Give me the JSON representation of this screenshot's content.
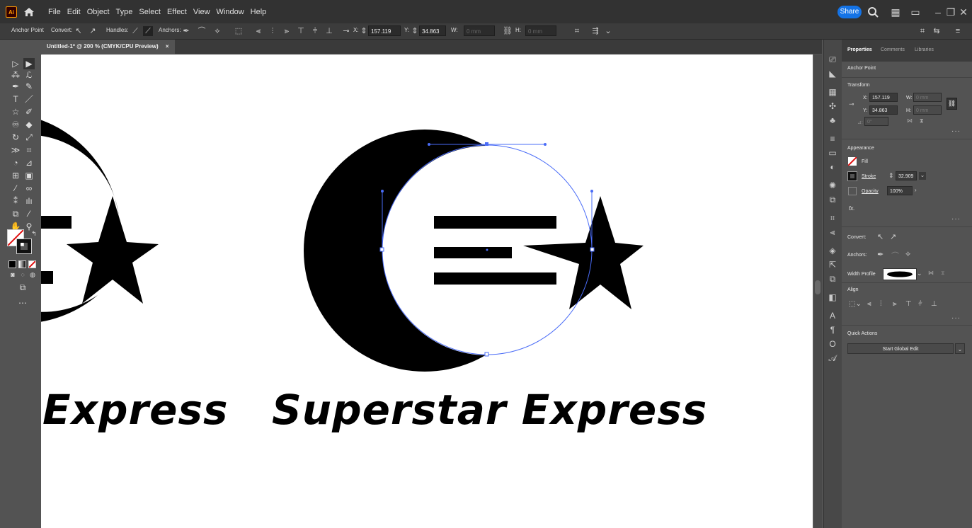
{
  "app": {
    "logo": "Ai"
  },
  "menu": [
    "File",
    "Edit",
    "Object",
    "Type",
    "Select",
    "Effect",
    "View",
    "Window",
    "Help"
  ],
  "topbar": {
    "share_label": "Share"
  },
  "control_bar": {
    "mode_label": "Anchor Point",
    "convert_label": "Convert:",
    "handles_label": "Handles:",
    "anchors_label": "Anchors:",
    "x_label": "X:",
    "x_value": "157.119 mm",
    "y_label": "Y:",
    "y_value": "34.863 mm",
    "w_label": "W:",
    "w_value": "0 mm",
    "h_label": "H:",
    "h_value": "0 mm"
  },
  "document_tab": {
    "title": "Untitled-1* @ 200 % (CMYK/CPU Preview)",
    "close": "×"
  },
  "artwork": {
    "left_text": "Express",
    "main_text": "Superstar Express"
  },
  "panel": {
    "tabs": [
      "Properties",
      "Comments",
      "Libraries"
    ],
    "selection_label": "Anchor Point",
    "transform": {
      "title": "Transform",
      "x_label": "X:",
      "x_value": "157.119 mr",
      "y_label": "Y:",
      "y_value": "34.863 mm",
      "w_label": "W:",
      "w_value": "0 mm",
      "h_label": "H:",
      "h_value": "0 mm",
      "angle_label": "⊿:",
      "angle_value": "0°"
    },
    "appearance": {
      "title": "Appearance",
      "fill_label": "Fill",
      "stroke_label": "Stroke",
      "stroke_value": "32.909",
      "opacity_label": "Opacity",
      "opacity_value": "100%",
      "fx_label": "fx."
    },
    "convert_label": "Convert:",
    "anchors_label": "Anchors:",
    "width_profile_label": "Width Profile",
    "align_title": "Align",
    "quick_actions_title": "Quick Actions",
    "start_global_edit": "Start Global Edit"
  },
  "colors": {
    "share": "#1473e6",
    "ai_orange": "#ff9a00",
    "selection": "#4a6cf7"
  }
}
